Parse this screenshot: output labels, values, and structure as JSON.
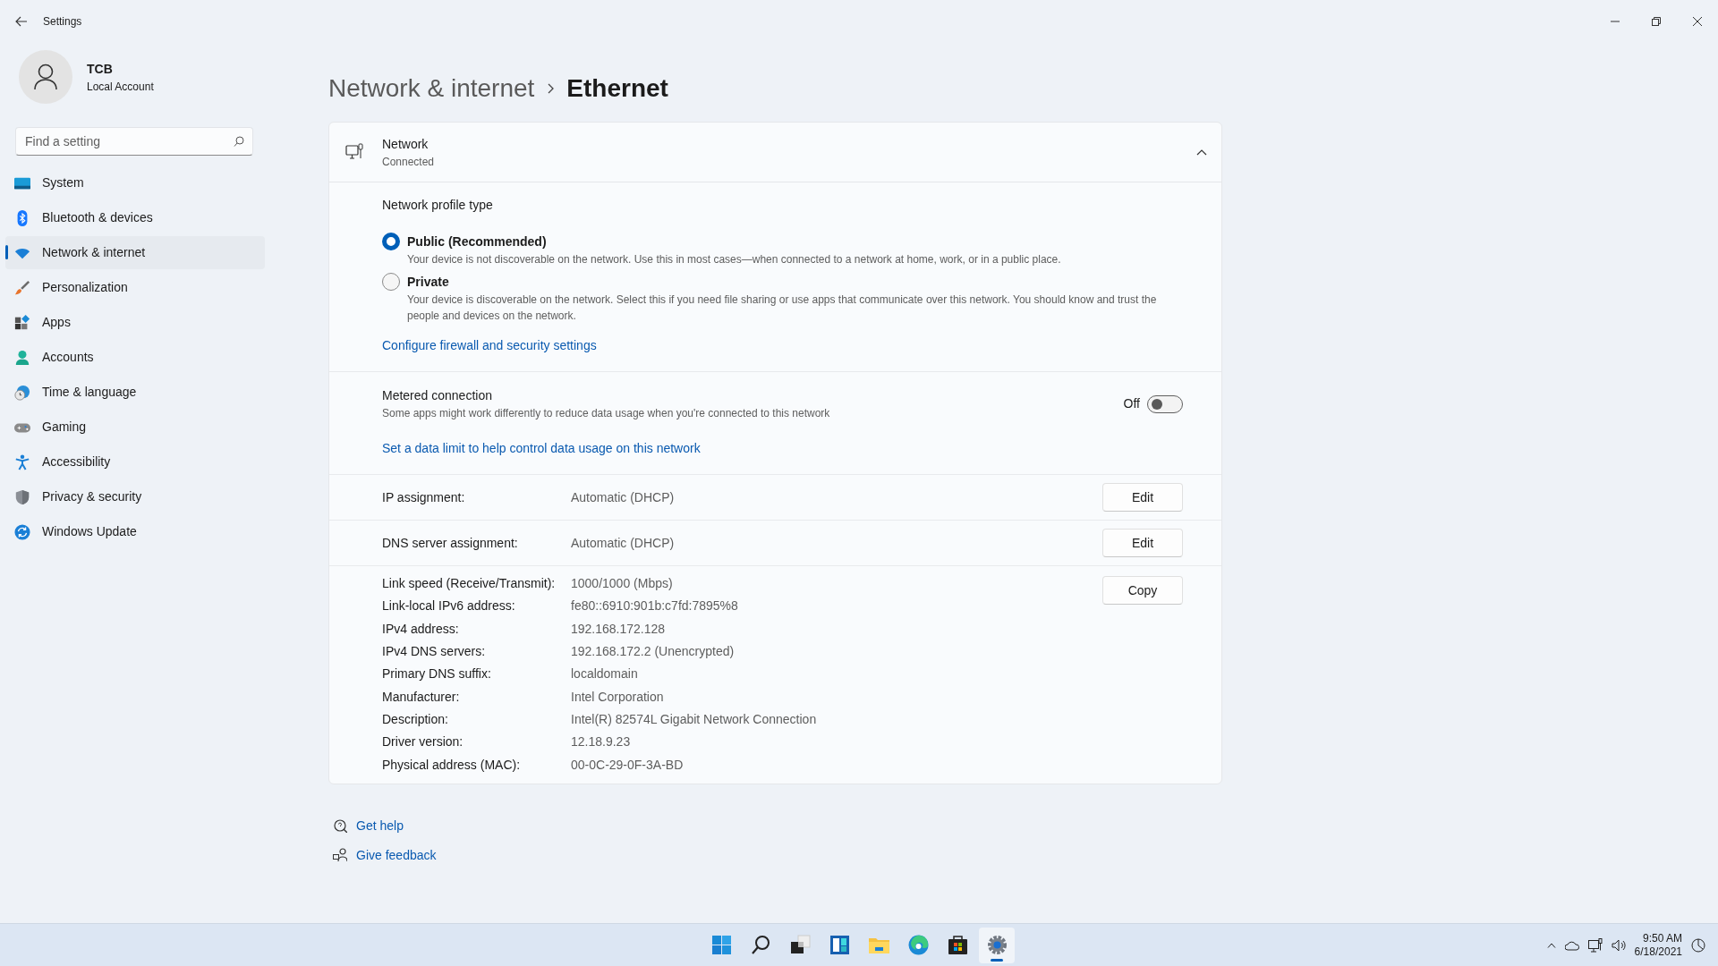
{
  "window": {
    "title": "Settings"
  },
  "account": {
    "name": "TCB",
    "type": "Local Account"
  },
  "search": {
    "placeholder": "Find a setting"
  },
  "sidebar": {
    "items": [
      {
        "kind": "system",
        "label": "System",
        "selected": false
      },
      {
        "kind": "bluetooth",
        "label": "Bluetooth & devices",
        "selected": false
      },
      {
        "kind": "network",
        "label": "Network & internet",
        "selected": true
      },
      {
        "kind": "personalization",
        "label": "Personalization",
        "selected": false
      },
      {
        "kind": "apps",
        "label": "Apps",
        "selected": false
      },
      {
        "kind": "accounts",
        "label": "Accounts",
        "selected": false
      },
      {
        "kind": "time",
        "label": "Time & language",
        "selected": false
      },
      {
        "kind": "gaming",
        "label": "Gaming",
        "selected": false
      },
      {
        "kind": "accessibility",
        "label": "Accessibility",
        "selected": false
      },
      {
        "kind": "privacy",
        "label": "Privacy & security",
        "selected": false
      },
      {
        "kind": "update",
        "label": "Windows Update",
        "selected": false
      }
    ]
  },
  "breadcrumb": {
    "parent": "Network & internet",
    "current": "Ethernet"
  },
  "network_card": {
    "title": "Network",
    "status": "Connected",
    "expanded": true,
    "profile": {
      "heading": "Network profile type",
      "options": [
        {
          "label": "Public (Recommended)",
          "description": "Your device is not discoverable on the network. Use this in most cases—when connected to a network at home, work, or in a public place.",
          "selected": true
        },
        {
          "label": "Private",
          "description": "Your device is discoverable on the network. Select this if you need file sharing or use apps that communicate over this network. You should know and trust the people and devices on the network.",
          "selected": false
        }
      ],
      "link": "Configure firewall and security settings"
    },
    "metered": {
      "title": "Metered connection",
      "description": "Some apps might work differently to reduce data usage when you're connected to this network",
      "toggle_label": "Off",
      "on": false,
      "link": "Set a data limit to help control data usage on this network"
    },
    "assignments": [
      {
        "label": "IP assignment:",
        "value": "Automatic (DHCP)",
        "button": "Edit"
      },
      {
        "label": "DNS server assignment:",
        "value": "Automatic (DHCP)",
        "button": "Edit"
      }
    ],
    "properties": [
      {
        "label": "Link speed (Receive/Transmit):",
        "value": "1000/1000 (Mbps)"
      },
      {
        "label": "Link-local IPv6 address:",
        "value": "fe80::6910:901b:c7fd:7895%8"
      },
      {
        "label": "IPv4 address:",
        "value": "192.168.172.128"
      },
      {
        "label": "IPv4 DNS servers:",
        "value": "192.168.172.2 (Unencrypted)"
      },
      {
        "label": "Primary DNS suffix:",
        "value": "localdomain"
      },
      {
        "label": "Manufacturer:",
        "value": "Intel Corporation"
      },
      {
        "label": "Description:",
        "value": "Intel(R) 82574L Gigabit Network Connection"
      },
      {
        "label": "Driver version:",
        "value": "12.18.9.23"
      },
      {
        "label": "Physical address (MAC):",
        "value": "00-0C-29-0F-3A-BD"
      }
    ],
    "copy_button": "Copy"
  },
  "help_links": [
    {
      "kind": "help",
      "label": "Get help"
    },
    {
      "kind": "feedback",
      "label": "Give feedback"
    }
  ],
  "taskbar": {
    "apps": [
      {
        "kind": "start",
        "selected": false
      },
      {
        "kind": "search",
        "selected": false
      },
      {
        "kind": "taskview",
        "selected": false
      },
      {
        "kind": "widgets",
        "selected": false
      },
      {
        "kind": "explorer",
        "selected": false
      },
      {
        "kind": "browser",
        "selected": false
      },
      {
        "kind": "store",
        "selected": false
      },
      {
        "kind": "settings",
        "selected": true
      }
    ]
  },
  "tray": {
    "time": "9:50 AM",
    "date": "6/18/2021"
  }
}
